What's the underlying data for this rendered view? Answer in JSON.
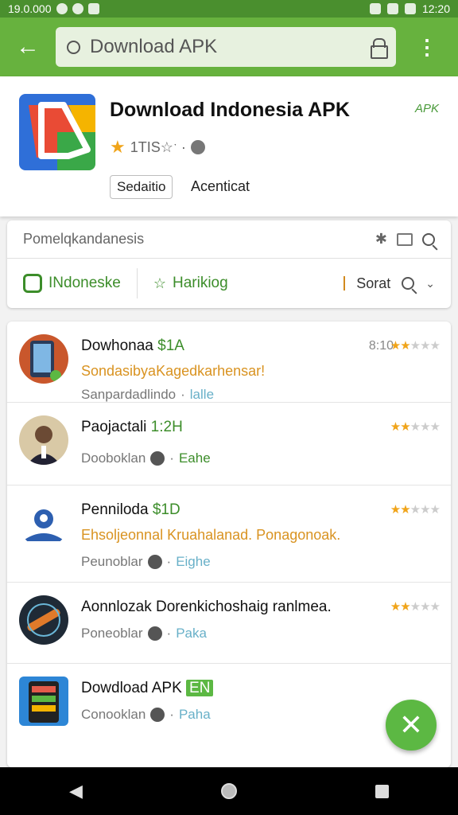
{
  "status_bar": {
    "left_text": "19.0.000",
    "time": "12:20"
  },
  "app_bar": {
    "back_icon": "arrow-left-icon",
    "search_text": "Download APK",
    "more_icon": "more-vertical-icon"
  },
  "header": {
    "title": "Download Indonesia APK",
    "apk_label": "APK",
    "rating_text": "1TIS☆ˑ ·",
    "chip_label": "Sedaitio",
    "secondary_link": "Acenticat"
  },
  "filter": {
    "label": "Pomelqkandanesis",
    "tab1_label": "INdoneske",
    "tab2_label": "Harikiog",
    "sort_label": "Sorat"
  },
  "list": [
    {
      "title": "Dowhonaa",
      "tag": "$1A",
      "desc": "SondasibyaKagedkarhensar!",
      "meta": "Sanpardadlindo",
      "extra": "lalle",
      "time": "8:10",
      "stars": 2
    },
    {
      "title": "Paojactali",
      "tag": "1:2H",
      "desc": "",
      "meta": "Dooboklan",
      "extra": "Eahe",
      "time": "",
      "stars": 2
    },
    {
      "title": "Penniloda",
      "tag": "$1D",
      "desc": "Ehsoljeonnal Kruahalanad. Ponagonoak.",
      "meta": "Peunoblar",
      "extra": "Eighe",
      "time": "",
      "stars": 2
    },
    {
      "title": "Aonnlozak Dorenkichoshaig ranlmea.",
      "tag": "",
      "desc": "",
      "meta": "Poneoblar",
      "extra": "Paka",
      "time": "",
      "stars": 2
    },
    {
      "title": "Dowdload APK",
      "tag": "EN",
      "desc": "",
      "meta": "Conooklan",
      "extra": "Paha",
      "time": "",
      "stars": 0
    }
  ],
  "fab_icon": "close-icon",
  "nav": {
    "back_icon": "nav-back-icon",
    "home_icon": "nav-home-icon",
    "recents_icon": "nav-recents-icon"
  }
}
